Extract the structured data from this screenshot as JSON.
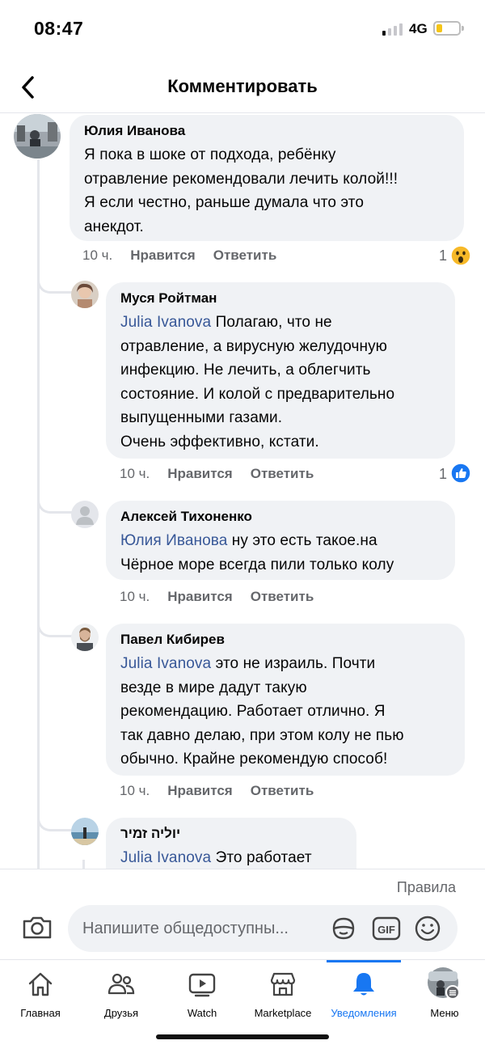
{
  "status_bar": {
    "time": "08:47",
    "network": "4G",
    "battery_level": 0.25
  },
  "header": {
    "title": "Комментировать"
  },
  "comments": [
    {
      "author": "Юлия Иванова",
      "mention": "",
      "text": "Я пока в шоке от подхода, ребёнку\nотравление рекомендовали лечить колой!!!\nЯ если честно, раньше думала что это\nанекдот.",
      "time": "10 ч.",
      "like_label": "Нравится",
      "reply_label": "Ответить",
      "reaction_count": "1",
      "reaction": "wow-icon"
    },
    {
      "author": "Муся Ройтман",
      "mention": "Julia  Ivanova",
      "text": " Полагаю, что не\nотравление, а вирусную желудочную\nинфекцию. Не лечить, а облегчить\nсостояние. И колой с предварительно\nвыпущенными газами.\nОчень эффективно, кстати.",
      "time": "10 ч.",
      "like_label": "Нравится",
      "reply_label": "Ответить",
      "reaction_count": "1",
      "reaction": "like-icon"
    },
    {
      "author": "Алексей Тихоненко",
      "mention": "Юлия Иванова",
      "text": " ну это есть такое.на\nЧёрное море всегда пили только колу",
      "time": "10 ч.",
      "like_label": "Нравится",
      "reply_label": "Ответить"
    },
    {
      "author": "Павел Кибирев",
      "mention": "Julia  Ivanova",
      "text": " это не израиль. Почти\nвезде в мире дадут такую\nрекомендацию. Работает отлично. Я\nтак давно делаю, при этом колу не пью\nобычно. Крайне рекомендую способ!",
      "time": "10 ч.",
      "like_label": "Нравится",
      "reply_label": "Ответить"
    },
    {
      "author": "יוליה זמיר",
      "mention": "Julia  Ivanova",
      "text": " Это работает"
    }
  ],
  "footer": {
    "rules_label": "Правила",
    "input_placeholder": "Напишите общедоступны..."
  },
  "tabs": [
    {
      "label": "Главная",
      "icon": "home-icon"
    },
    {
      "label": "Друзья",
      "icon": "friends-icon"
    },
    {
      "label": "Watch",
      "icon": "watch-icon"
    },
    {
      "label": "Marketplace",
      "icon": "marketplace-icon"
    },
    {
      "label": "Уведомления",
      "icon": "bell-icon",
      "active": true
    },
    {
      "label": "Меню",
      "icon": "menu-avatar-icon"
    }
  ],
  "colors": {
    "accent": "#1877f2",
    "bubble": "#f0f2f5",
    "mention": "#385898",
    "secondary_text": "#65676b"
  }
}
